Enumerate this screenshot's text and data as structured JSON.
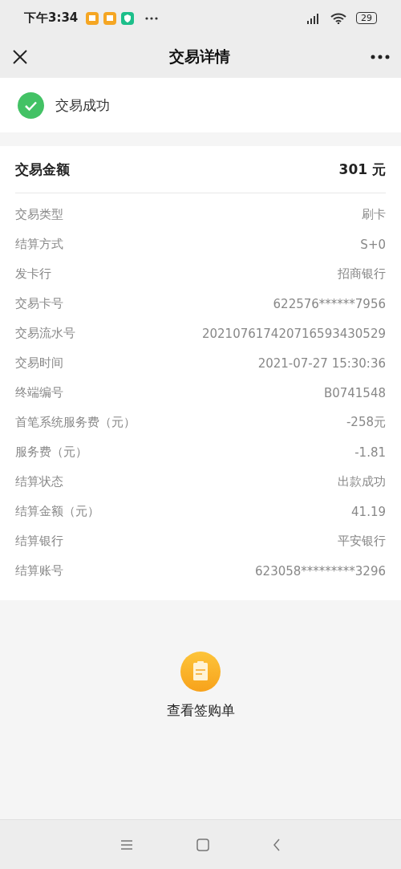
{
  "status_bar": {
    "time": "下午3:34",
    "battery": "29"
  },
  "nav": {
    "title": "交易详情"
  },
  "result": {
    "text": "交易成功",
    "success": true
  },
  "amount": {
    "label": "交易金额",
    "value": "301 元"
  },
  "details": [
    {
      "label": "交易类型",
      "value": "刷卡"
    },
    {
      "label": "结算方式",
      "value": "S+0"
    },
    {
      "label": "发卡行",
      "value": "招商银行"
    },
    {
      "label": "交易卡号",
      "value": "622576******7956"
    },
    {
      "label": "交易流水号",
      "value": "202107617420716593430529"
    },
    {
      "label": "交易时间",
      "value": "2021-07-27 15:30:36"
    },
    {
      "label": "终端编号",
      "value": "B0741548"
    },
    {
      "label": "首笔系统服务费（元）",
      "value": "-258元"
    },
    {
      "label": "服务费（元）",
      "value": "-1.81"
    },
    {
      "label": "结算状态",
      "value": "出款成功"
    },
    {
      "label": "结算金额（元）",
      "value": "41.19"
    },
    {
      "label": "结算银行",
      "value": "平安银行"
    },
    {
      "label": "结算账号",
      "value": "623058*********3296"
    }
  ],
  "receipt_link": {
    "label": "查看签购单"
  }
}
